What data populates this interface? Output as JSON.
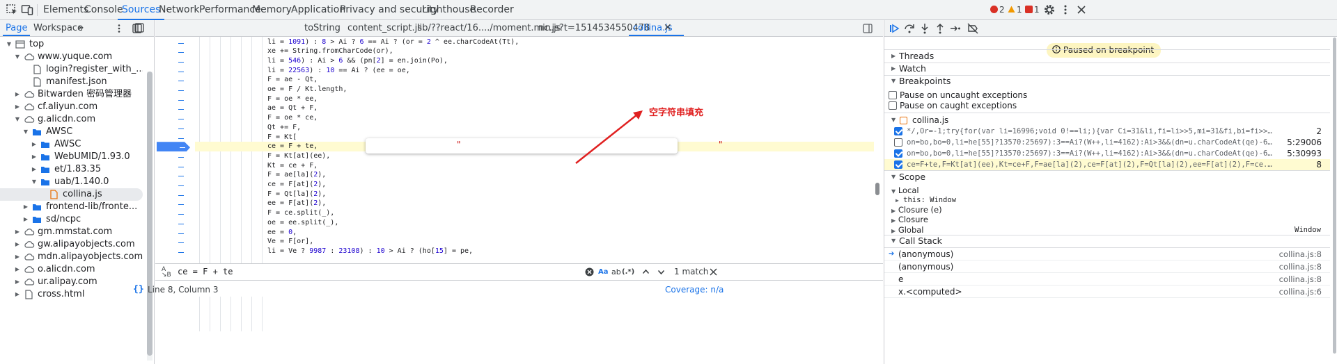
{
  "toolbar": {
    "tabs": [
      "Elements",
      "Console",
      "Sources",
      "Network",
      "Performance",
      "Memory",
      "Application",
      "Privacy and security",
      "Lighthouse",
      "Recorder"
    ],
    "active_tab": "Sources",
    "errors_count": "2",
    "warnings_count": "1",
    "issues_count": "1"
  },
  "navigator": {
    "tabs": [
      "Page",
      "Workspace"
    ],
    "more": "»",
    "tree": [
      {
        "label": "top",
        "depth": 0,
        "expanded": true,
        "icon": "frame"
      },
      {
        "label": "www.yuque.com",
        "depth": 1,
        "expanded": true,
        "icon": "cloud"
      },
      {
        "label": "login?register_with_...",
        "depth": 2,
        "icon": "file"
      },
      {
        "label": "manifest.json",
        "depth": 2,
        "icon": "file"
      },
      {
        "label": "Bitwarden 密码管理器",
        "depth": 1,
        "expanded": false,
        "icon": "cloud"
      },
      {
        "label": "cf.aliyun.com",
        "depth": 1,
        "expanded": false,
        "icon": "cloud"
      },
      {
        "label": "g.alicdn.com",
        "depth": 1,
        "expanded": true,
        "icon": "cloud"
      },
      {
        "label": "AWSC",
        "depth": 2,
        "expanded": true,
        "icon": "folder"
      },
      {
        "label": "AWSC",
        "depth": 3,
        "expanded": false,
        "icon": "folder"
      },
      {
        "label": "WebUMID/1.93.0",
        "depth": 3,
        "expanded": false,
        "icon": "folder"
      },
      {
        "label": "et/1.83.35",
        "depth": 3,
        "expanded": false,
        "icon": "folder"
      },
      {
        "label": "uab/1.140.0",
        "depth": 3,
        "expanded": true,
        "icon": "folder"
      },
      {
        "label": "collina.js",
        "depth": 4,
        "icon": "jsfile",
        "selected": true
      },
      {
        "label": "frontend-lib/fronte...",
        "depth": 2,
        "expanded": false,
        "icon": "folder"
      },
      {
        "label": "sd/ncpc",
        "depth": 2,
        "expanded": false,
        "icon": "folder"
      },
      {
        "label": "gm.mmstat.com",
        "depth": 1,
        "expanded": false,
        "icon": "cloud"
      },
      {
        "label": "gw.alipayobjects.com",
        "depth": 1,
        "expanded": false,
        "icon": "cloud"
      },
      {
        "label": "mdn.alipayobjects.com",
        "depth": 1,
        "expanded": false,
        "icon": "cloud"
      },
      {
        "label": "o.alicdn.com",
        "depth": 1,
        "expanded": false,
        "icon": "cloud"
      },
      {
        "label": "ur.alipay.com",
        "depth": 1,
        "expanded": false,
        "icon": "cloud"
      },
      {
        "label": "cross.html",
        "depth": 1,
        "expanded": false,
        "icon": "file"
      }
    ]
  },
  "editor": {
    "tabs": [
      "toString",
      "content_script.js",
      "lib/??react/16..../moment.min.js",
      "nc.js?t=1514534550478",
      "collina.js"
    ],
    "active_tab": "collina.js",
    "code_lines": [
      "li = 1091) : 8 > Ai ? 6 == Ai ? (or = 2 ^ ee.charCodeAt(Tt),",
      "xe += String.fromCharCode(or),",
      "li = 546) : Ai > 6 && (pn[2] = en.join(Po),",
      "li = 22563) : 10 == Ai ? (ee = oe,",
      "F = ae - Qt,",
      "oe = F / Kt.length,",
      "F = oe * ee,",
      "ae = Qt + F,",
      "F = oe * ce,",
      "Qt += F,",
      "F = Kt[",
      "ce = F + te,",
      "F = Kt[at](ee),",
      "Kt = ce + F,",
      "F = ae[la](2),",
      "ce = F[at](2),",
      "F = Qt[la](2),",
      "ee = F[at](2),",
      "F = ce.split(_),",
      "oe = ee.split(_),",
      "ee = 0,",
      "Ve = F[or],",
      "li = Ve ? 9987 : 23108) : 10 > Ai ? (ho[15] = pe,"
    ],
    "breakpoint_line_index": 11,
    "annotation_text": "空字符串填充",
    "popup_quote_open": "\"",
    "popup_quote_close": "\"",
    "search_query": "ce = F + te",
    "search_case_label": "Aa",
    "search_regex_label": "(.*)",
    "match_count": "1 match",
    "cursor_position": "Line 8, Column 3",
    "coverage": "Coverage: n/a"
  },
  "debugger": {
    "paused_text": "Paused on breakpoint",
    "sections": {
      "threads": "Threads",
      "watch": "Watch",
      "breakpoints": "Breakpoints",
      "scope": "Scope",
      "call_stack": "Call Stack"
    },
    "pause_uncaught": "Pause on uncaught exceptions",
    "pause_caught": "Pause on caught exceptions",
    "bp_file": "collina.js",
    "breakpoints": [
      {
        "checked": true,
        "code": "*/,Or=-1;try{for(var li=16996;void 0!==li;){var Ci=31&li,fi=li>>5,mi=31&fi,bi=fi>>5,Ai=31&bi",
        "line": "2"
      },
      {
        "checked": false,
        "code": "on=bo,bo=0,li=he[55]?13570:25697):3==Ai?(W++,li=4162):Ai>3&&(dn=u.charCodeAt(qe)-641,Q...",
        "line": "5:29006"
      },
      {
        "checked": true,
        "code": "on=bo,bo=0,li=he[55]?13570:25697):3==Ai?(W++,li=4162):Ai>3&&(dn=u.charCodeAt(qe)-641,Q...",
        "line": "5:30993"
      },
      {
        "checked": true,
        "code": "ce=F+te,F=Kt[at](ee),Kt=ce+F,F=ae[la](2),ce=F[at](2),F=Qt[la](2),ee=F[at](2),F=ce.split(_),o...",
        "line": "8",
        "current": true
      }
    ],
    "scope": {
      "local": "Local",
      "this_label": "this: Window",
      "closure_e": "Closure (e)",
      "closure": "Closure",
      "global": "Global",
      "global_value": "Window"
    },
    "call_stack": [
      {
        "name": "(anonymous)",
        "loc": "collina.js:8",
        "current": true
      },
      {
        "name": "(anonymous)",
        "loc": "collina.js:8"
      },
      {
        "name": "e",
        "loc": "collina.js:8"
      },
      {
        "name": "x.<computed>",
        "loc": "collina.js:6"
      }
    ]
  },
  "colors": {
    "accent": "#1a73e8",
    "error": "#d93025",
    "warning": "#f29900",
    "highlight": "#fffbd1",
    "annotation": "#e02020"
  }
}
